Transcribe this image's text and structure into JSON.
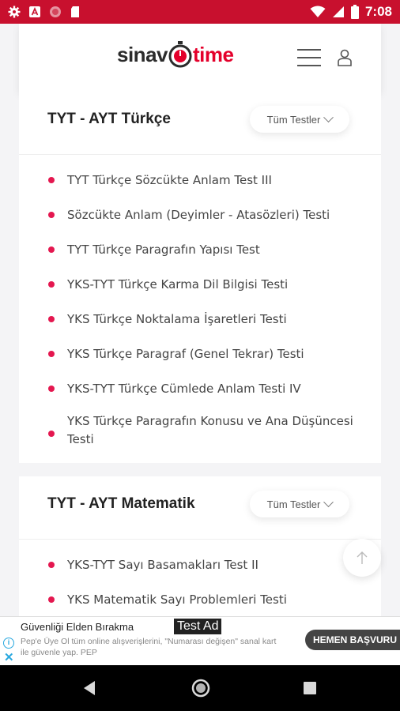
{
  "status_bar": {
    "time": "7:08",
    "icons": [
      "settings-icon",
      "app-a-icon",
      "record-icon",
      "sd-card-icon",
      "wifi-icon",
      "signal-icon",
      "battery-icon"
    ]
  },
  "header": {
    "logo_left": "sinav",
    "logo_right": "time",
    "icons": [
      "menu-icon",
      "user-icon"
    ]
  },
  "sections": [
    {
      "title": "TYT - AYT Türkçe",
      "filter_label": "Tüm Testler",
      "items": [
        "TYT Türkçe Sözcükte Anlam Test III",
        "Sözcükte Anlam (Deyimler - Atasözleri) Testi",
        "TYT Türkçe Paragrafın Yapısı Test",
        "YKS-TYT Türkçe Karma Dil Bilgisi Testi",
        "YKS Türkçe Noktalama İşaretleri Testi",
        "YKS Türkçe Paragraf (Genel Tekrar) Testi",
        "YKS-TYT Türkçe Cümlede Anlam Testi IV",
        "YKS Türkçe Paragrafın Konusu ve Ana Düşüncesi Testi"
      ]
    },
    {
      "title": "TYT - AYT Matematik",
      "filter_label": "Tüm Testler",
      "items": [
        "YKS-TYT Sayı Basamakları Test II",
        "YKS Matematik Sayı Problemleri Testi"
      ]
    }
  ],
  "ad": {
    "title": "Güvenliği Elden Bırakma",
    "tag": "Test Ad",
    "text_line1": "Pep'e Üye Ol tüm online alışverişlerini, \"Numarası değişen\" sanal kart",
    "text_line2": "ile güvenle yap. PEP",
    "cta": "HEMEN BAŞVURU"
  },
  "colors": {
    "status_bar": "#c8102e",
    "brand_red": "#e4002b",
    "bullet": "#e4174f",
    "ad_info": "#29a8df"
  }
}
